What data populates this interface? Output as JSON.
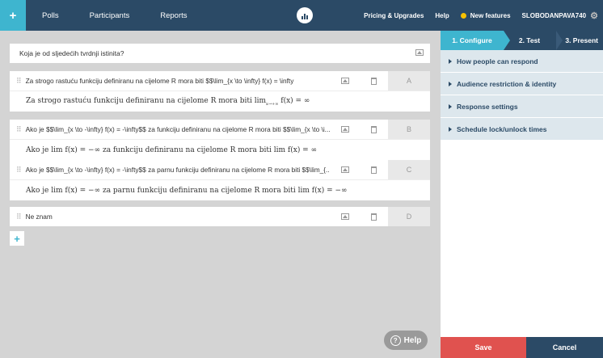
{
  "nav": {
    "add_label": "+",
    "links": [
      "Polls",
      "Participants",
      "Reports"
    ],
    "pricing": "Pricing & Upgrades",
    "help": "Help",
    "new_features": "New features",
    "user": "SLOBODANPAVA740"
  },
  "question": {
    "text": "Koja je od sljedećih tvrdnji istinita?"
  },
  "options": [
    {
      "source": "Za strogo rastuću funkciju definiranu na cijelome R mora biti $$\\lim_{x \\to \\infty} f(x) = \\infty",
      "preview": "Za strogo rastuću funkciju definiranu na cijelome R mora biti lim",
      "letter": "A"
    },
    {
      "source": "Ako je $$\\lim_{x \\to -\\infty} f(x) = -\\infty$$  za funkciju definiranu na cijelome R mora biti $$\\lim_{x \\to \\i...",
      "preview": "Ako je lim f(x) = −∞ za funkciju definiranu na cijelome R mora biti lim f(x) = ∞",
      "letter": "B"
    },
    {
      "source": "Ako je $$\\lim_{x \\to -\\infty} f(x) = -\\infty$$  za parnu funkciju definiranu na cijelome R mora biti $$\\lim_{...",
      "preview": "Ako je lim f(x) = −∞ za parnu funkciju definiranu na cijelome R mora biti lim f(x) = −∞",
      "letter": "C"
    },
    {
      "source": "Ne znam",
      "letter": "D"
    }
  ],
  "help_button": "Help",
  "side": {
    "steps": [
      "1. Configure",
      "2. Test",
      "3. Present"
    ],
    "sections": [
      "How people can respond",
      "Audience restriction & identity",
      "Response settings",
      "Schedule lock/unlock times"
    ],
    "save": "Save",
    "cancel": "Cancel"
  }
}
